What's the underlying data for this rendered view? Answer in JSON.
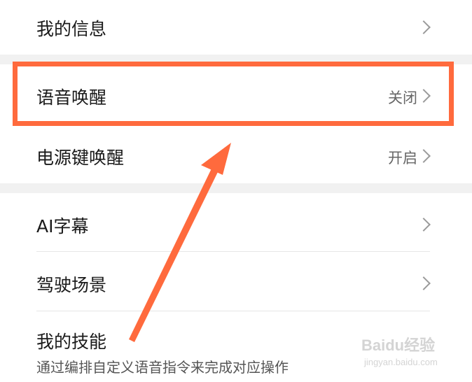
{
  "menu": {
    "items": [
      {
        "label": "我的信息",
        "value": ""
      },
      {
        "label": "语音唤醒",
        "value": "关闭"
      },
      {
        "label": "电源键唤醒",
        "value": "开启"
      },
      {
        "label": "AI字幕",
        "value": ""
      },
      {
        "label": "驾驶场景",
        "value": ""
      },
      {
        "label": "我的技能",
        "value": ""
      }
    ],
    "skills_description": "通过编排自定义语音指令来完成对应操作"
  },
  "watermark": {
    "brand": "Baidu经验",
    "url": "jingyan.baidu.com"
  },
  "colors": {
    "highlight": "#ff6a3d",
    "gap": "#f1f1f1",
    "chevron": "#9a9a9a"
  }
}
